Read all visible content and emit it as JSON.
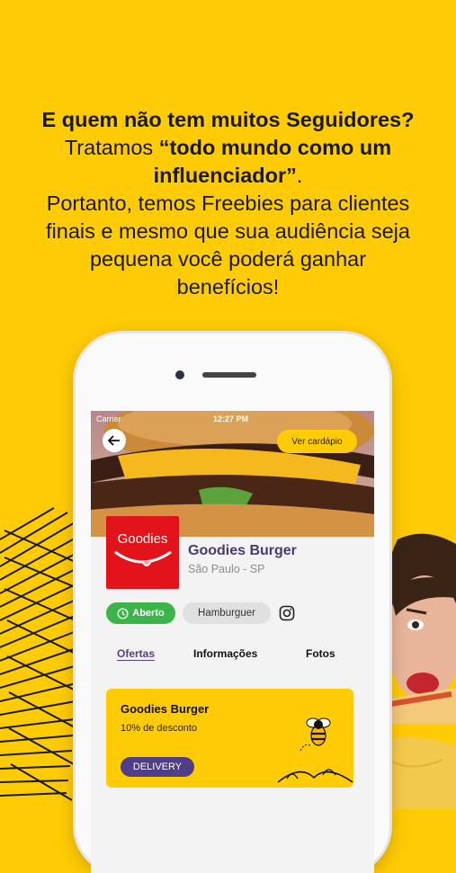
{
  "headline": {
    "line1": "E quem não tem muitos Seguidores?",
    "line2_prefix": "Tratamos ",
    "line2_bold": "“todo mundo como um",
    "line3_bold": "influenciador”",
    "line3_suffix": ".",
    "line4": "Portanto, temos Freebies para clientes",
    "line5": "finais e mesmo que sua audiência seja",
    "line6": "pequena você poderá ganhar",
    "line7": "benefícios!"
  },
  "status_bar": {
    "carrier": "Carrier",
    "time": "12:27 PM"
  },
  "header": {
    "menu_button": "Ver cardápio"
  },
  "restaurant": {
    "logo_text": "Goodies",
    "name": "Goodies Burger",
    "location": "São Paulo - SP",
    "status": "Aberto",
    "category": "Hamburguer"
  },
  "tabs": [
    {
      "label": "Ofertas",
      "active": true
    },
    {
      "label": "Informações",
      "active": false
    },
    {
      "label": "Fotos",
      "active": false
    }
  ],
  "offer": {
    "title": "Goodies Burger",
    "discount": "10% de desconto",
    "badge": "DELIVERY"
  },
  "colors": {
    "background": "#FFCB05",
    "accent_purple": "#4f3f87",
    "open_green": "#3bb54a",
    "brand_red": "#E3131B"
  }
}
